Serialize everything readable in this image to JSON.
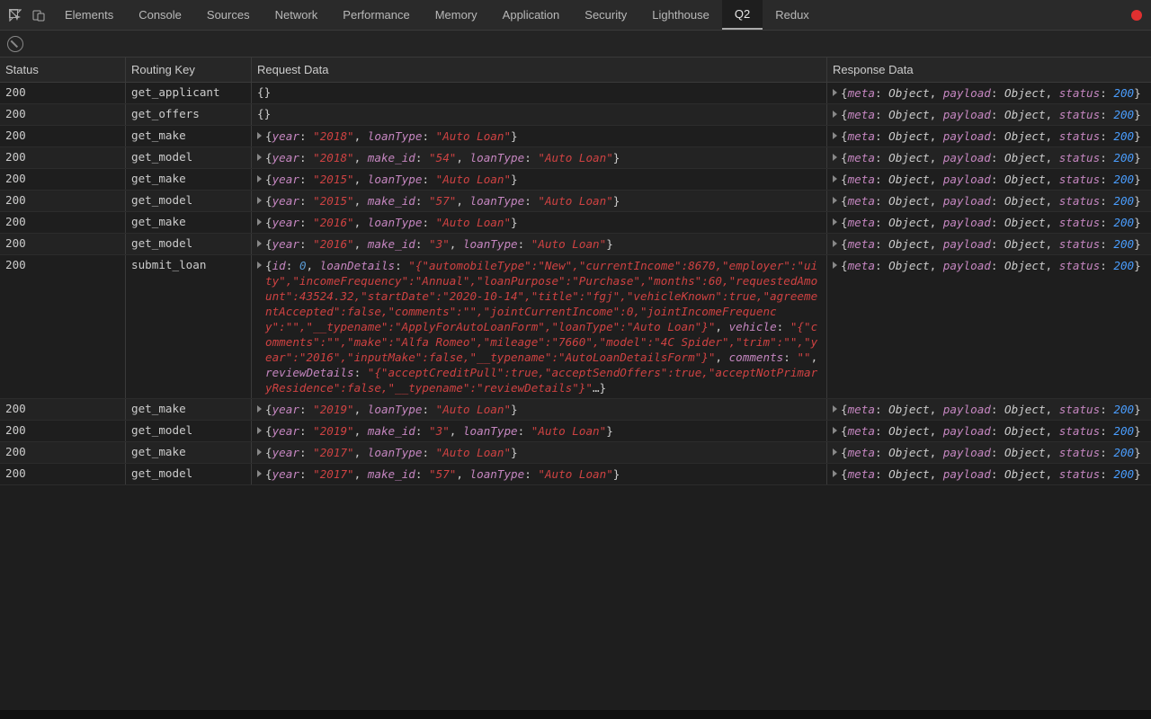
{
  "topTabs": {
    "items": [
      "Elements",
      "Console",
      "Sources",
      "Network",
      "Performance",
      "Memory",
      "Application",
      "Security",
      "Lighthouse",
      "Q2",
      "Redux"
    ],
    "active": 9
  },
  "headers": {
    "status": "Status",
    "routing_key": "Routing Key",
    "request_data": "Request Data",
    "response_data": "Response Data"
  },
  "response_template": {
    "meta_key": "meta",
    "meta_val": "Object",
    "payload_key": "payload",
    "payload_val": "Object",
    "status_key": "status",
    "status_val": "200"
  },
  "rows": [
    {
      "status": "200",
      "key": "get_applicant",
      "req": {
        "type": "empty"
      }
    },
    {
      "status": "200",
      "key": "get_offers",
      "req": {
        "type": "empty"
      }
    },
    {
      "status": "200",
      "key": "get_make",
      "req": {
        "type": "make",
        "year": "2018",
        "loanType": "Auto Loan"
      }
    },
    {
      "status": "200",
      "key": "get_model",
      "req": {
        "type": "model",
        "year": "2018",
        "make_id": "54",
        "loanType": "Auto Loan"
      }
    },
    {
      "status": "200",
      "key": "get_make",
      "req": {
        "type": "make",
        "year": "2015",
        "loanType": "Auto Loan"
      }
    },
    {
      "status": "200",
      "key": "get_model",
      "req": {
        "type": "model",
        "year": "2015",
        "make_id": "57",
        "loanType": "Auto Loan"
      }
    },
    {
      "status": "200",
      "key": "get_make",
      "req": {
        "type": "make",
        "year": "2016",
        "loanType": "Auto Loan"
      }
    },
    {
      "status": "200",
      "key": "get_model",
      "req": {
        "type": "model",
        "year": "2016",
        "make_id": "3",
        "loanType": "Auto Loan"
      }
    },
    {
      "status": "200",
      "key": "submit_loan",
      "req": {
        "type": "submit",
        "id": "0",
        "loanDetails": "{\"automobileType\":\"New\",\"currentIncome\":8670,\"employer\":\"uity\",\"incomeFrequency\":\"Annual\",\"loanPurpose\":\"Purchase\",\"months\":60,\"requestedAmount\":43524.32,\"startDate\":\"2020-10-14\",\"title\":\"fgj\",\"vehicleKnown\":true,\"agreementAccepted\":false,\"comments\":\"\",\"jointCurrentIncome\":0,\"jointIncomeFrequency\":\"\",\"__typename\":\"ApplyForAutoLoanForm\",\"loanType\":\"Auto Loan\"}",
        "vehicle": "{\"comments\":\"\",\"make\":\"Alfa Romeo\",\"mileage\":\"7660\",\"model\":\"4C Spider\",\"trim\":\"\",\"year\":\"2016\",\"inputMake\":false,\"__typename\":\"AutoLoanDetailsForm\"}",
        "comments": "",
        "reviewDetails": "{\"acceptCreditPull\":true,\"acceptSendOffers\":true,\"acceptNotPrimaryResidence\":false,\"__typename\":\"reviewDetails\"}"
      }
    },
    {
      "status": "200",
      "key": "get_make",
      "req": {
        "type": "make",
        "year": "2019",
        "loanType": "Auto Loan"
      }
    },
    {
      "status": "200",
      "key": "get_model",
      "req": {
        "type": "model",
        "year": "2019",
        "make_id": "3",
        "loanType": "Auto Loan"
      }
    },
    {
      "status": "200",
      "key": "get_make",
      "req": {
        "type": "make",
        "year": "2017",
        "loanType": "Auto Loan"
      }
    },
    {
      "status": "200",
      "key": "get_model",
      "req": {
        "type": "model",
        "year": "2017",
        "make_id": "57",
        "loanType": "Auto Loan"
      }
    }
  ]
}
